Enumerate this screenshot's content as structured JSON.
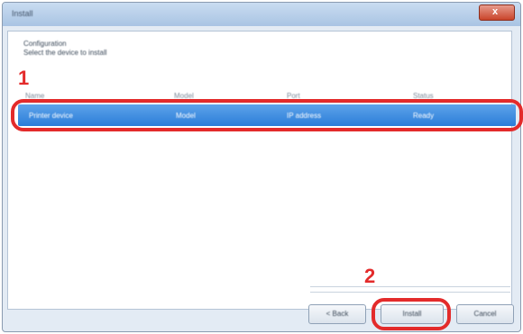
{
  "window": {
    "title": "Install",
    "close_label": "x"
  },
  "instructions": {
    "line1": "Configuration",
    "line2": "Select the device to install"
  },
  "list": {
    "columns": [
      "Name",
      "Model",
      "Port",
      "Status"
    ],
    "selected_row": {
      "name": "Printer device",
      "model": "Model",
      "port": "IP address",
      "status": "Ready"
    }
  },
  "annotations": {
    "step1": "1",
    "step2": "2"
  },
  "buttons": {
    "back": "< Back",
    "install": "Install",
    "cancel": "Cancel"
  },
  "colors": {
    "annotation_red": "#e32b2b",
    "selection_blue": "#2b7dd8"
  }
}
